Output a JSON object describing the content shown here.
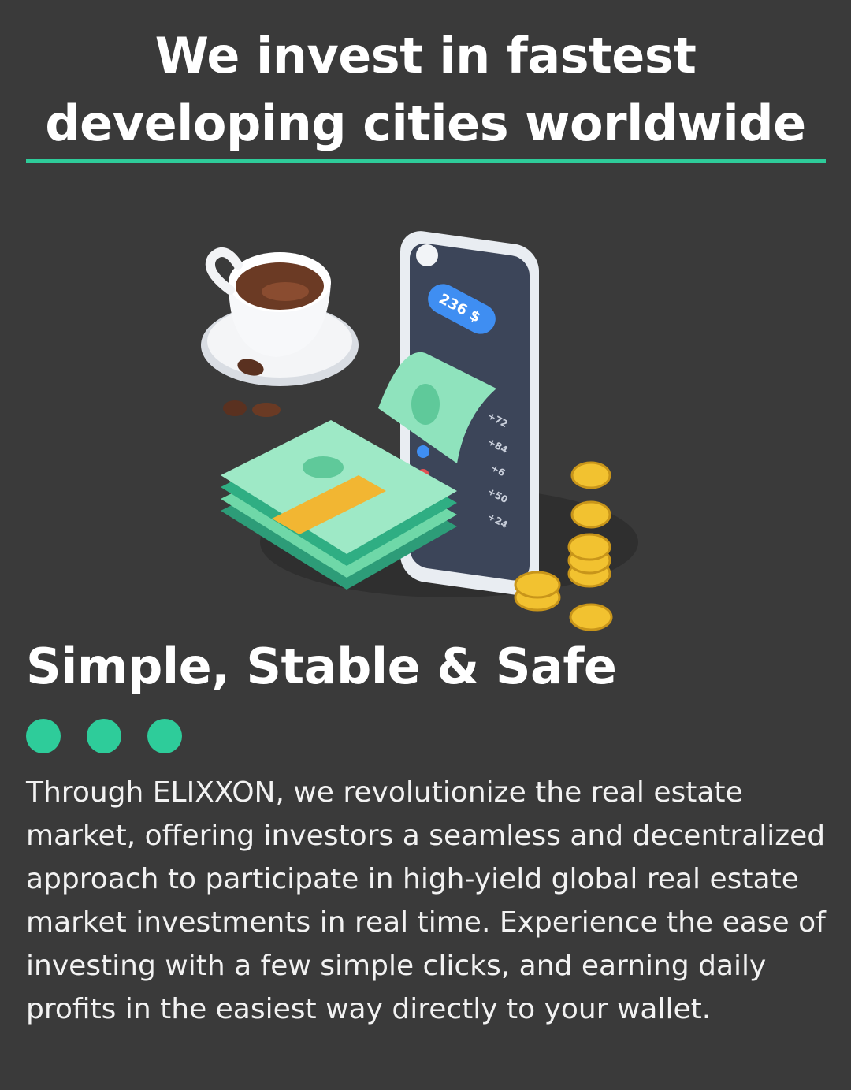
{
  "header": {
    "title_line1": "We invest in fastest",
    "title_line2": "developing cities worldwide"
  },
  "illustration": {
    "balance_badge": "236 $",
    "transactions": [
      "+72",
      "+84",
      "+6",
      "+50",
      "+24"
    ],
    "accent_color": "#2ecc9a"
  },
  "section": {
    "title": "Simple, Stable & Safe",
    "dots_count": 3,
    "body": "Through ELIXXON, we revolutionize the real estate market, offering investors a seamless and decentralized approach to participate in high-yield global real estate market investments in real time. Experience the ease of investing with a few simple clicks, and earning daily profits in the easiest way directly to your wallet."
  },
  "colors": {
    "background": "#3a3a3a",
    "accent": "#2ecc9a",
    "text": "#ffffff"
  }
}
